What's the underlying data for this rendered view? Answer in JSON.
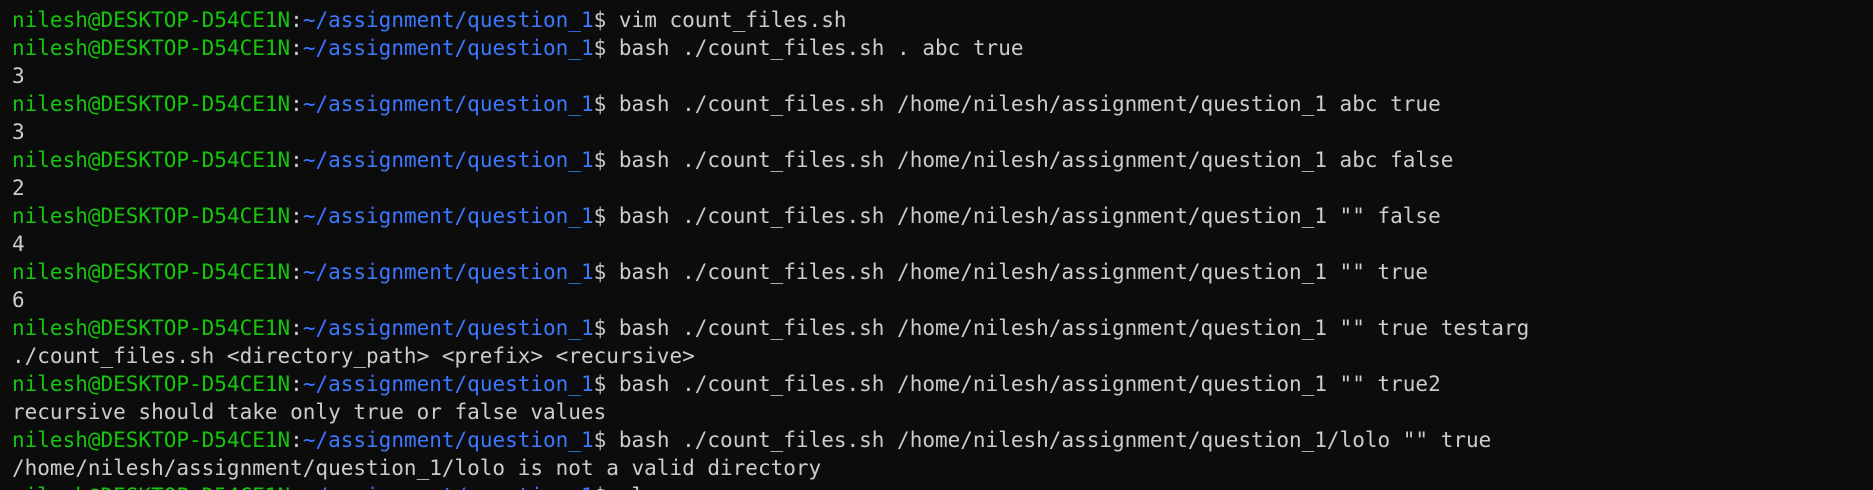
{
  "colors": {
    "background": "#0c0c0c",
    "user": "#16c60c",
    "path": "#3b78ff",
    "text": "#cccccc"
  },
  "prompt": {
    "user": "nilesh@DESKTOP-D54CE1N",
    "sep": ":",
    "path": "~/assignment/question_1",
    "symbol": "$ "
  },
  "lines": [
    {
      "type": "cmd",
      "text": "vim count_files.sh"
    },
    {
      "type": "cmd",
      "text": "bash ./count_files.sh . abc true"
    },
    {
      "type": "out",
      "text": "3"
    },
    {
      "type": "cmd",
      "text": "bash ./count_files.sh /home/nilesh/assignment/question_1 abc true"
    },
    {
      "type": "out",
      "text": "3"
    },
    {
      "type": "cmd",
      "text": "bash ./count_files.sh /home/nilesh/assignment/question_1 abc false"
    },
    {
      "type": "out",
      "text": "2"
    },
    {
      "type": "cmd",
      "text": "bash ./count_files.sh /home/nilesh/assignment/question_1 \"\" false"
    },
    {
      "type": "out",
      "text": "4"
    },
    {
      "type": "cmd",
      "text": "bash ./count_files.sh /home/nilesh/assignment/question_1 \"\" true"
    },
    {
      "type": "out",
      "text": "6"
    },
    {
      "type": "cmd",
      "text": "bash ./count_files.sh /home/nilesh/assignment/question_1 \"\" true testarg"
    },
    {
      "type": "out",
      "text": "./count_files.sh <directory_path> <prefix> <recursive>"
    },
    {
      "type": "cmd",
      "text": "bash ./count_files.sh /home/nilesh/assignment/question_1 \"\" true2"
    },
    {
      "type": "out",
      "text": "recursive should take only true or false values"
    },
    {
      "type": "cmd",
      "text": "bash ./count_files.sh /home/nilesh/assignment/question_1/lolo \"\" true"
    },
    {
      "type": "out",
      "text": "/home/nilesh/assignment/question_1/lolo is not a valid directory"
    },
    {
      "type": "cmd",
      "text": "cl"
    }
  ]
}
